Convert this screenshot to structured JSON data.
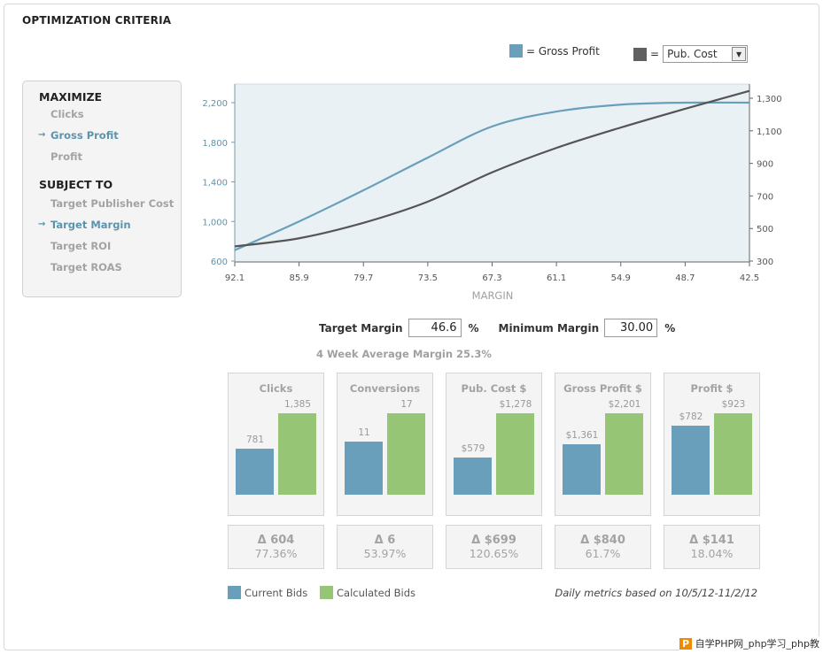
{
  "title": "OPTIMIZATION CRITERIA",
  "sidebar": {
    "maximize_heading": "MAXIMIZE",
    "maximize_items": [
      {
        "label": "Clicks",
        "selected": false
      },
      {
        "label": "Gross Profit",
        "selected": true
      },
      {
        "label": "Profit",
        "selected": false
      }
    ],
    "subject_heading": "SUBJECT TO",
    "subject_items": [
      {
        "label": "Target Publisher Cost",
        "selected": false
      },
      {
        "label": "Target Margin",
        "selected": true
      },
      {
        "label": "Target ROI",
        "selected": false
      },
      {
        "label": "Target ROAS",
        "selected": false
      }
    ],
    "arrow_icon": "→"
  },
  "legend": {
    "gross_profit": "= Gross Profit",
    "equals": "=",
    "select_value": "Pub. Cost",
    "gross_color": "#6a9fbb",
    "cost_color": "#606060"
  },
  "chart_data": {
    "type": "line",
    "xlabel": "MARGIN",
    "x": [
      92.1,
      85.9,
      79.7,
      73.5,
      67.3,
      61.1,
      54.9,
      48.7,
      42.5
    ],
    "x_reversed": true,
    "left_axis": {
      "ticks": [
        "600",
        "1,000",
        "1,400",
        "1,800",
        "2,200"
      ],
      "range": [
        600,
        2400
      ]
    },
    "right_axis": {
      "ticks": [
        "300",
        "500",
        "700",
        "900",
        "1,100",
        "1,300"
      ],
      "range": [
        300,
        1390
      ]
    },
    "series": [
      {
        "name": "Gross Profit",
        "axis": "left",
        "color": "#6a9fbb",
        "values": [
          710,
          1000,
          1315,
          1645,
          1960,
          2110,
          2180,
          2200,
          2200
        ]
      },
      {
        "name": "Pub. Cost",
        "axis": "right",
        "color": "#555555",
        "values": [
          390,
          440,
          535,
          665,
          845,
          995,
          1120,
          1235,
          1345
        ]
      }
    ],
    "plot_bg": "#eaf1f5"
  },
  "margins": {
    "target_label": "Target Margin",
    "target_value": "46.6",
    "min_label": "Minimum Margin",
    "min_value": "30.00",
    "pct": "%"
  },
  "average": "4 Week Average Margin 25.3%",
  "metrics": [
    {
      "title": "Clicks",
      "current": 781,
      "calculated": 1385,
      "current_label": "781",
      "calculated_label": "1,385",
      "delta": "Δ 604",
      "pct": "77.36%"
    },
    {
      "title": "Conversions",
      "current": 11,
      "calculated": 17,
      "current_label": "11",
      "calculated_label": "17",
      "delta": "Δ 6",
      "pct": "53.97%"
    },
    {
      "title": "Pub. Cost $",
      "current": 579,
      "calculated": 1278,
      "current_label": "$579",
      "calculated_label": "$1,278",
      "delta": "Δ $699",
      "pct": "120.65%"
    },
    {
      "title": "Gross Profit $",
      "current": 1361,
      "calculated": 2201,
      "current_label": "$1,361",
      "calculated_label": "$2,201",
      "delta": "Δ $840",
      "pct": "61.7%"
    },
    {
      "title": "Profit $",
      "current": 782,
      "calculated": 923,
      "current_label": "$782",
      "calculated_label": "$923",
      "delta": "Δ $141",
      "pct": "18.04%"
    }
  ],
  "bar_legend": {
    "current": "Current Bids",
    "calculated": "Calculated Bids",
    "current_color": "#6a9fbb",
    "calculated_color": "#96c675"
  },
  "note": "Daily metrics based on 10/5/12-11/2/12",
  "watermark": "自学PHP网_php学习_php教"
}
